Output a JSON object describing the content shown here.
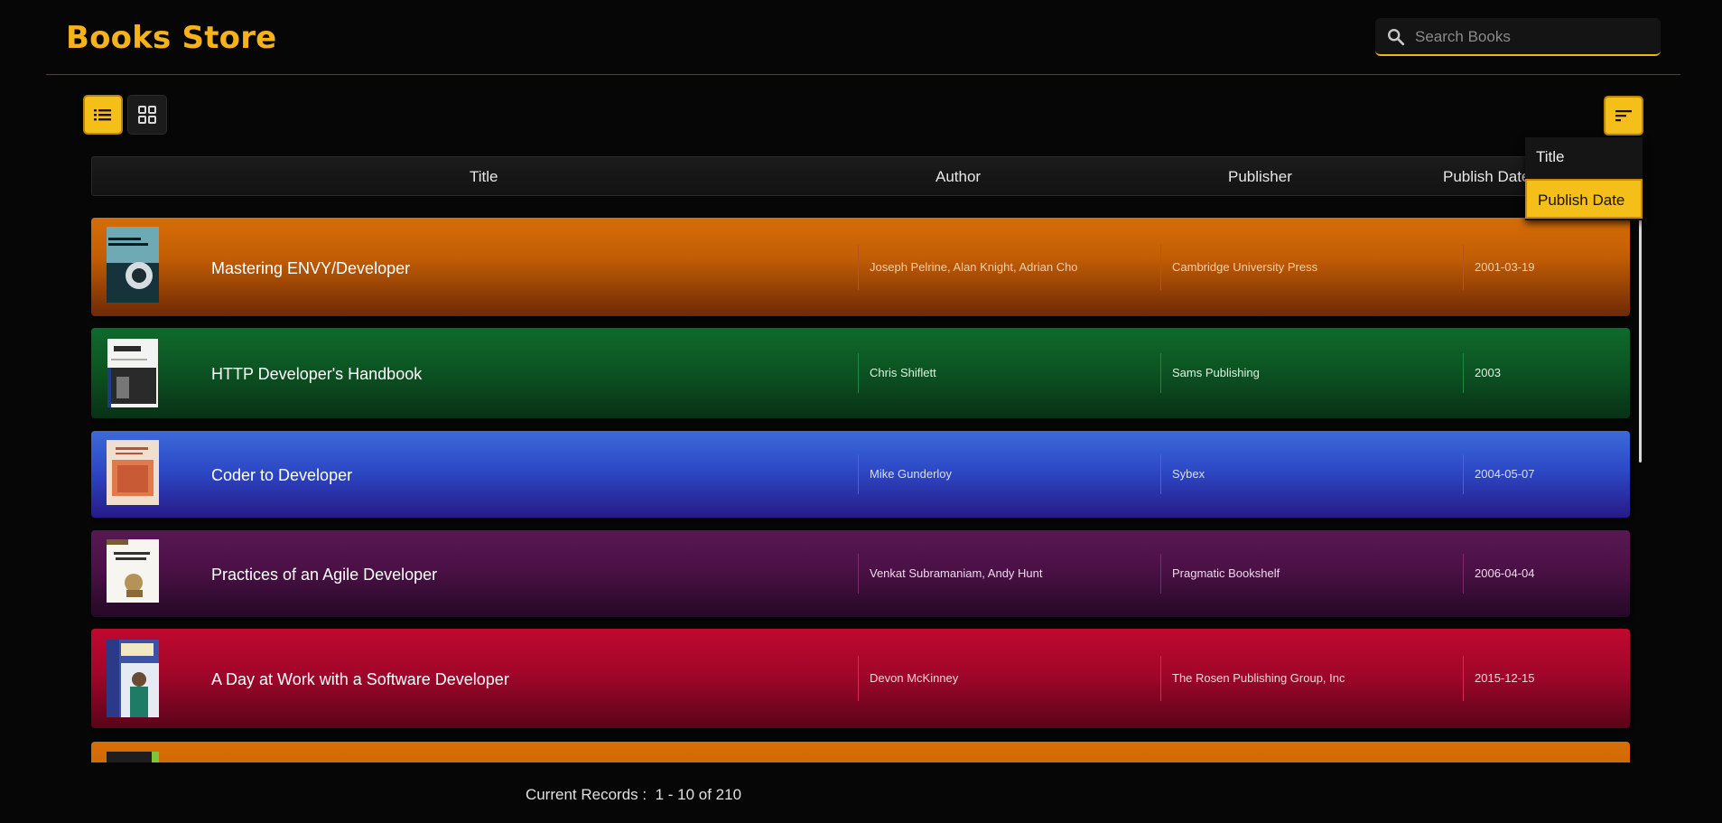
{
  "app": {
    "title": "Books Store"
  },
  "search": {
    "placeholder": "Search Books",
    "value": ""
  },
  "view": {
    "active": "list",
    "buttons": [
      "list-view",
      "grid-view"
    ]
  },
  "columns": [
    "Title",
    "Author",
    "Publisher",
    "Publish Date"
  ],
  "sort_menu": {
    "options": [
      "Title",
      "Publish Date"
    ],
    "selected": "Publish Date"
  },
  "books": [
    {
      "title": "Mastering ENVY/Developer",
      "author": "Joseph Pelrine, Alan Knight, Adrian Cho",
      "publisher": "Cambridge University Press",
      "date": "2001-03-19"
    },
    {
      "title": "HTTP Developer's Handbook",
      "author": "Chris Shiflett",
      "publisher": "Sams Publishing",
      "date": "2003"
    },
    {
      "title": "Coder to Developer",
      "author": "Mike Gunderloy",
      "publisher": "Sybex",
      "date": "2004-05-07"
    },
    {
      "title": "Practices of an Agile Developer",
      "author": "Venkat Subramaniam, Andy Hunt",
      "publisher": "Pragmatic Bookshelf",
      "date": "2006-04-04"
    },
    {
      "title": "A Day at Work with a Software Developer",
      "author": "Devon McKinney",
      "publisher": "The Rosen Publishing Group, Inc",
      "date": "2015-12-15"
    }
  ],
  "footer": {
    "label": "Current Records :",
    "range": "1 - 10 of 210"
  },
  "colors": {
    "accent": "#f5bf1a",
    "background": "#060606"
  }
}
